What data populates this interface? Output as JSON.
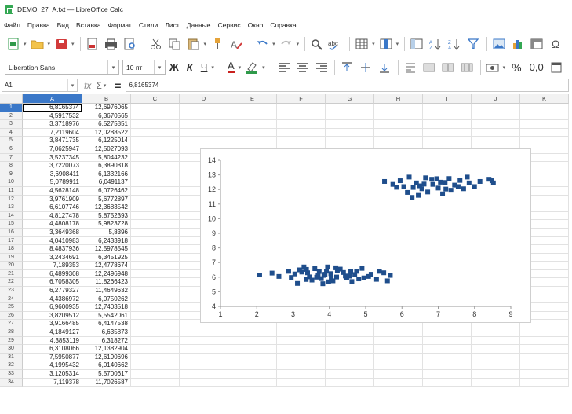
{
  "window": {
    "title": "DEMO_27_A.txt — LibreOffice Calc"
  },
  "menu": [
    "Файл",
    "Правка",
    "Вид",
    "Вставка",
    "Формат",
    "Стили",
    "Лист",
    "Данные",
    "Сервис",
    "Окно",
    "Справка"
  ],
  "toolbar2": {
    "font_name": "Liberation Sans",
    "font_size": "10 пт",
    "bold_label": "Ж",
    "italic_label": "К",
    "underline_label": "Ч",
    "font_color_label": "A",
    "percent_label": "%",
    "decimal_label": "0,0"
  },
  "formula_bar": {
    "cell_ref": "A1",
    "fx_label": "fx",
    "sigma_label": "Σ",
    "equals_label": "=",
    "content": "6,8165374"
  },
  "columns": [
    "A",
    "B",
    "C",
    "D",
    "E",
    "F",
    "G",
    "H",
    "I",
    "J",
    "K"
  ],
  "rows": [
    [
      "6,8165374",
      "12,6976065"
    ],
    [
      "4,5917532",
      "6,3670565"
    ],
    [
      "3,3718976",
      "6,5275851"
    ],
    [
      "7,2119604",
      "12,0288522"
    ],
    [
      "3,8471735",
      "6,1225014"
    ],
    [
      "7,0625947",
      "12,5027093"
    ],
    [
      "3,5237345",
      "5,8044232"
    ],
    [
      "3,7220073",
      "6,3890818"
    ],
    [
      "3,6908411",
      "6,1332166"
    ],
    [
      "5,0789911",
      "6,0491137"
    ],
    [
      "4,5628148",
      "6,0726462"
    ],
    [
      "3,9761909",
      "5,6772897"
    ],
    [
      "6,6107746",
      "12,3683542"
    ],
    [
      "4,8127478",
      "5,8752393"
    ],
    [
      "4,4808178",
      "5,9823728"
    ],
    [
      "3,3649368",
      "5,8396"
    ],
    [
      "4,0410983",
      "6,2433918"
    ],
    [
      "8,4837936",
      "12,5978545"
    ],
    [
      "3,2434691",
      "6,3451925"
    ],
    [
      "7,189353",
      "12,4778674"
    ],
    [
      "6,4899308",
      "12,2496948"
    ],
    [
      "6,7058305",
      "11,8266423"
    ],
    [
      "6,2779327",
      "11,4649632"
    ],
    [
      "4,4386972",
      "6,0750262"
    ],
    [
      "6,9600935",
      "12,7403518"
    ],
    [
      "3,8209512",
      "5,5542061"
    ],
    [
      "3,9166485",
      "6,4147538"
    ],
    [
      "4,1849127",
      "6,635873"
    ],
    [
      "4,3853119",
      "6,318272"
    ],
    [
      "6,3108066",
      "12,1382904"
    ],
    [
      "7,5950877",
      "12,6190696"
    ],
    [
      "4,1995432",
      "6,0140662"
    ],
    [
      "3,1205314",
      "5,5700617"
    ],
    [
      "7,119378",
      "11,7026587"
    ]
  ],
  "chart_data": {
    "type": "scatter",
    "title": "",
    "xlabel": "",
    "ylabel": "",
    "xlim": [
      1,
      9
    ],
    "ylim": [
      4,
      14
    ],
    "x_ticks": [
      "1",
      "2",
      "3",
      "4",
      "5",
      "6",
      "7",
      "8",
      "9"
    ],
    "y_ticks": [
      "4",
      "5",
      "6",
      "7",
      "8",
      "9",
      "10",
      "11",
      "12",
      "13",
      "14"
    ],
    "grid": false,
    "marker_color": "#1f4e8c",
    "series": [
      {
        "points": [
          [
            6.82,
            12.7
          ],
          [
            4.59,
            6.37
          ],
          [
            3.37,
            6.53
          ],
          [
            7.21,
            12.03
          ],
          [
            3.85,
            6.12
          ],
          [
            7.06,
            12.5
          ],
          [
            3.52,
            5.8
          ],
          [
            3.72,
            6.39
          ],
          [
            3.69,
            6.13
          ],
          [
            5.08,
            6.05
          ],
          [
            4.56,
            6.07
          ],
          [
            3.98,
            5.68
          ],
          [
            6.61,
            12.37
          ],
          [
            4.81,
            5.88
          ],
          [
            4.48,
            5.98
          ],
          [
            3.36,
            5.84
          ],
          [
            4.04,
            6.24
          ],
          [
            8.48,
            12.6
          ],
          [
            3.24,
            6.35
          ],
          [
            7.19,
            12.48
          ],
          [
            6.49,
            12.25
          ],
          [
            6.71,
            11.83
          ],
          [
            6.28,
            11.46
          ],
          [
            4.44,
            6.08
          ],
          [
            6.96,
            12.74
          ],
          [
            3.82,
            5.55
          ],
          [
            3.92,
            6.41
          ],
          [
            4.18,
            6.64
          ],
          [
            4.39,
            6.32
          ],
          [
            6.31,
            12.14
          ],
          [
            7.6,
            12.62
          ],
          [
            4.2,
            6.01
          ],
          [
            3.12,
            5.57
          ],
          [
            7.12,
            11.7
          ],
          [
            2.08,
            6.15
          ],
          [
            2.42,
            6.28
          ],
          [
            2.61,
            6.05
          ],
          [
            2.88,
            6.4
          ],
          [
            3.05,
            6.22
          ],
          [
            3.18,
            6.5
          ],
          [
            3.45,
            6.02
          ],
          [
            3.6,
            6.58
          ],
          [
            3.78,
            5.9
          ],
          [
            3.95,
            6.7
          ],
          [
            4.1,
            5.75
          ],
          [
            4.3,
            6.55
          ],
          [
            4.62,
            5.7
          ],
          [
            4.75,
            6.4
          ],
          [
            4.95,
            5.95
          ],
          [
            5.15,
            6.2
          ],
          [
            5.3,
            5.85
          ],
          [
            5.5,
            6.3
          ],
          [
            3.4,
            6.3
          ],
          [
            3.65,
            6.0
          ],
          [
            3.88,
            6.2
          ],
          [
            4.05,
            5.95
          ],
          [
            4.22,
            6.45
          ],
          [
            4.7,
            6.18
          ],
          [
            5.38,
            6.4
          ],
          [
            5.6,
            5.75
          ],
          [
            5.68,
            6.12
          ],
          [
            4.9,
            6.6
          ],
          [
            2.95,
            5.98
          ],
          [
            3.3,
            6.7
          ],
          [
            5.52,
            12.55
          ],
          [
            5.75,
            12.35
          ],
          [
            5.95,
            12.6
          ],
          [
            6.05,
            12.2
          ],
          [
            6.2,
            12.85
          ],
          [
            6.4,
            12.45
          ],
          [
            6.55,
            12.05
          ],
          [
            6.85,
            12.35
          ],
          [
            7.0,
            12.1
          ],
          [
            7.3,
            12.75
          ],
          [
            7.45,
            12.3
          ],
          [
            7.7,
            12.05
          ],
          [
            7.85,
            12.45
          ],
          [
            8.0,
            12.2
          ],
          [
            8.15,
            12.55
          ],
          [
            8.4,
            12.7
          ],
          [
            8.52,
            12.45
          ],
          [
            6.45,
            11.6
          ],
          [
            6.15,
            11.8
          ],
          [
            7.35,
            11.95
          ],
          [
            7.8,
            12.85
          ],
          [
            5.85,
            12.15
          ],
          [
            6.65,
            12.8
          ],
          [
            7.55,
            12.2
          ]
        ]
      }
    ]
  }
}
